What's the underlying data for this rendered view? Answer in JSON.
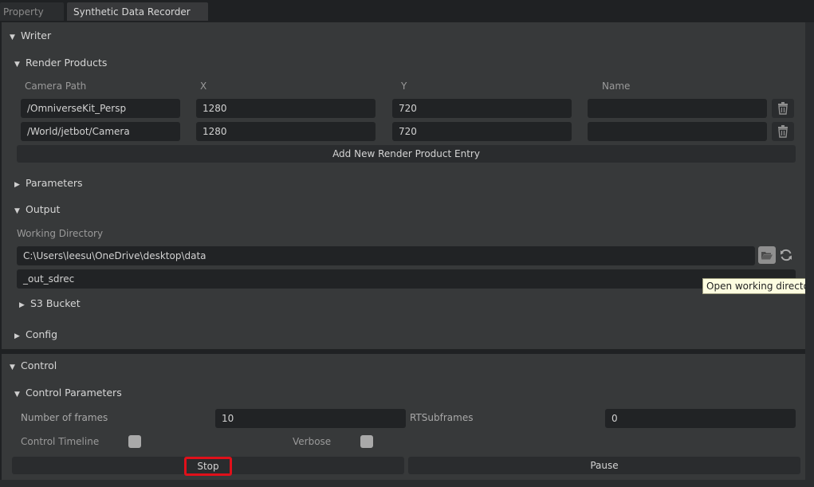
{
  "tabs": [
    {
      "label": "Property"
    },
    {
      "label": "Synthetic Data Recorder"
    }
  ],
  "writer": {
    "title": "Writer",
    "render_products": {
      "title": "Render Products",
      "columns": [
        "Camera Path",
        "X",
        "Y",
        "Name"
      ],
      "rows": [
        {
          "camera_path": "/OmniverseKit_Persp",
          "x": "1280",
          "y": "720",
          "name": ""
        },
        {
          "camera_path": "/World/jetbot/Camera",
          "x": "1280",
          "y": "720",
          "name": ""
        }
      ],
      "add_button": "Add New Render Product Entry"
    },
    "parameters": {
      "title": "Parameters"
    },
    "output": {
      "title": "Output",
      "working_directory_label": "Working Directory",
      "working_directory": "C:\\Users\\leesu\\OneDrive\\desktop\\data",
      "output_folder": "_out_sdrec",
      "s3_bucket": "S3 Bucket"
    },
    "config": {
      "title": "Config"
    }
  },
  "tooltip": "Open working directory",
  "control": {
    "title": "Control",
    "params": {
      "title": "Control Parameters",
      "num_frames_label": "Number of frames",
      "num_frames": "10",
      "rt_subframes_label": "RTSubframes",
      "rt_subframes": "0",
      "control_timeline_label": "Control Timeline",
      "verbose_label": "Verbose"
    },
    "stop_label": "Stop",
    "pause_label": "Pause"
  },
  "icons": {
    "expanded": "triangle-down-icon",
    "collapsed": "triangle-right-icon",
    "trash": "trash-icon",
    "folder": "folder-open-icon",
    "refresh": "refresh-icon"
  }
}
